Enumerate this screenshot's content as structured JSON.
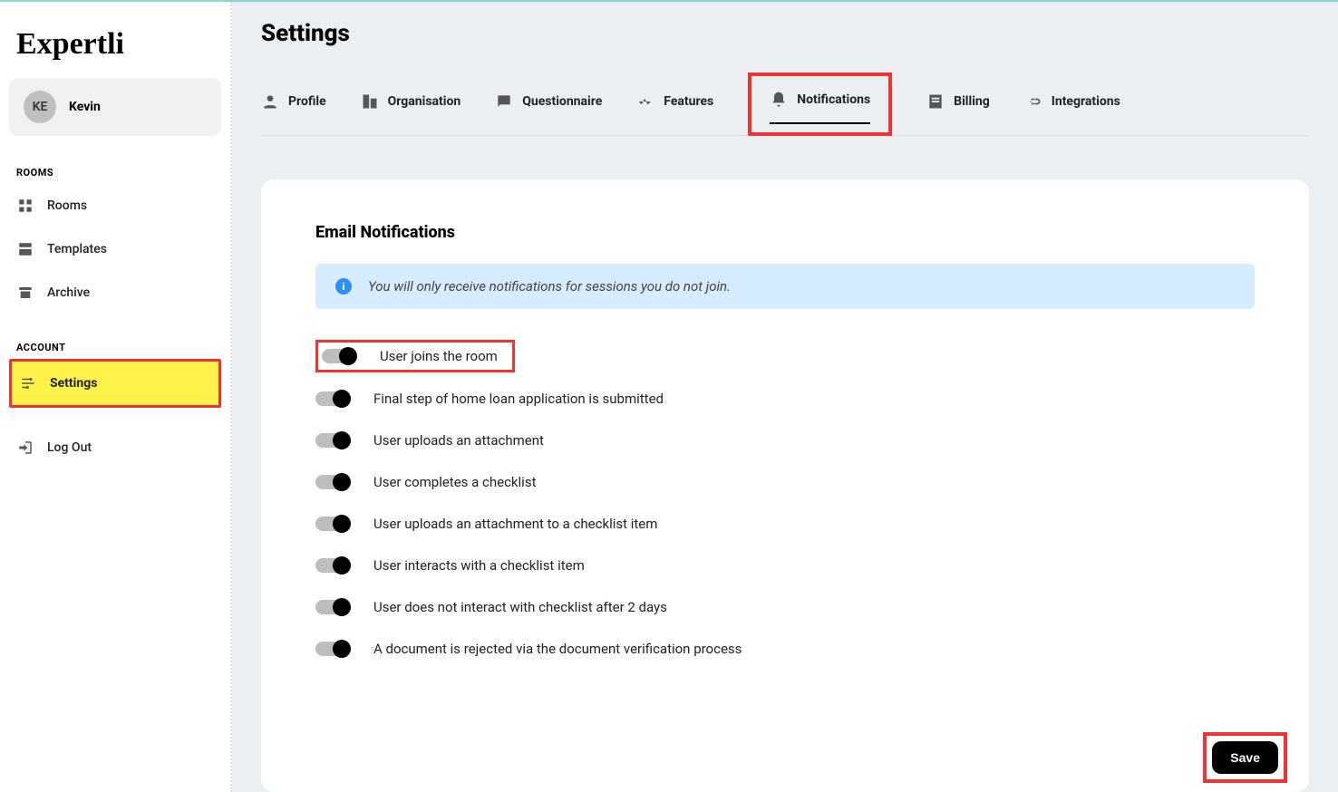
{
  "logo": "Expertli",
  "user": {
    "initials": "KE",
    "name": "Kevin"
  },
  "sidebar": {
    "section_rooms": "ROOMS",
    "section_account": "ACCOUNT",
    "items": {
      "rooms": "Rooms",
      "templates": "Templates",
      "archive": "Archive",
      "settings": "Settings",
      "logout": "Log Out"
    }
  },
  "page": {
    "title": "Settings"
  },
  "tabs": {
    "profile": "Profile",
    "organisation": "Organisation",
    "questionnaire": "Questionnaire",
    "features": "Features",
    "notifications": "Notifications",
    "billing": "Billing",
    "integrations": "Integrations"
  },
  "notifications": {
    "section_title": "Email Notifications",
    "info": "You will only receive notifications for sessions you do not join.",
    "items": [
      "User joins the room",
      "Final step of home loan application is submitted",
      "User uploads an attachment",
      "User completes a checklist",
      "User uploads an attachment to a checklist item",
      "User interacts with a checklist item",
      "User does not interact with checklist after 2 days",
      "A document is rejected via the document verification process"
    ],
    "save_label": "Save"
  }
}
